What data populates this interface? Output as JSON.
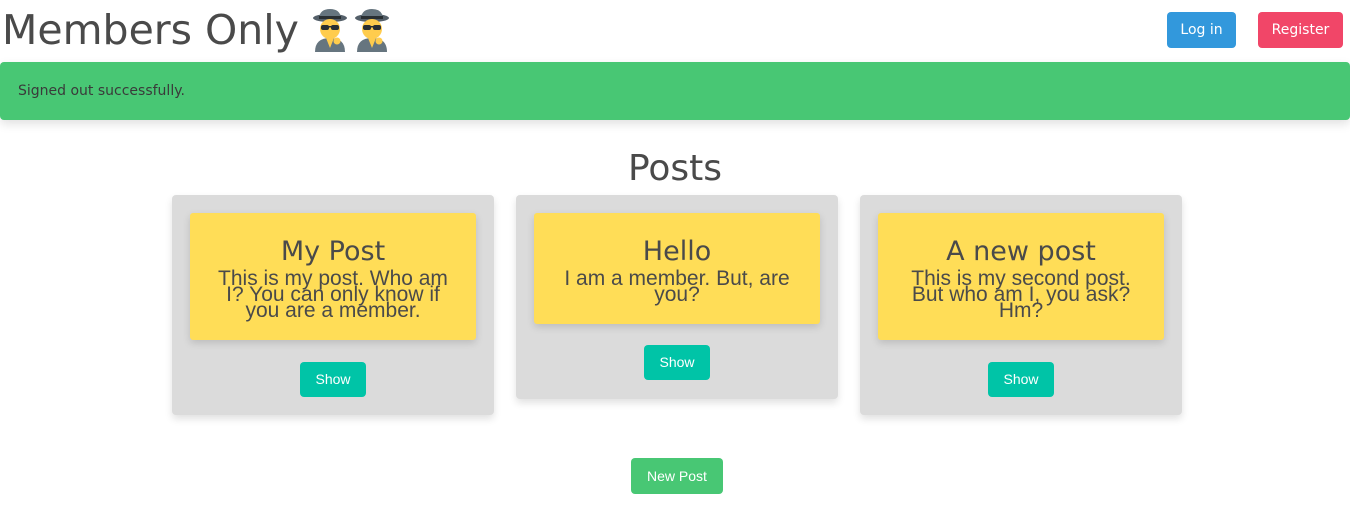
{
  "header": {
    "title": "Members Only",
    "emoji_icons": [
      "detective-icon",
      "detective-icon"
    ],
    "login_label": "Log in",
    "register_label": "Register"
  },
  "flash": {
    "message": "Signed out successfully."
  },
  "main": {
    "heading": "Posts",
    "posts": [
      {
        "title": "My Post",
        "body": "This is my post. Who am I? You can only know if you are a member.",
        "show_label": "Show"
      },
      {
        "title": "Hello",
        "body": "I am a member. But, are you?",
        "show_label": "Show"
      },
      {
        "title": "A new post",
        "body": "This is my second post. But who am I, you ask? Hm?",
        "show_label": "Show"
      }
    ],
    "new_post_label": "New Post"
  },
  "colors": {
    "login": "#3298dc",
    "register": "#f14668",
    "flash": "#48c774",
    "card": "#dbdbdb",
    "note": "#ffdd57",
    "show": "#00c4a7",
    "new_post": "#48c774"
  }
}
